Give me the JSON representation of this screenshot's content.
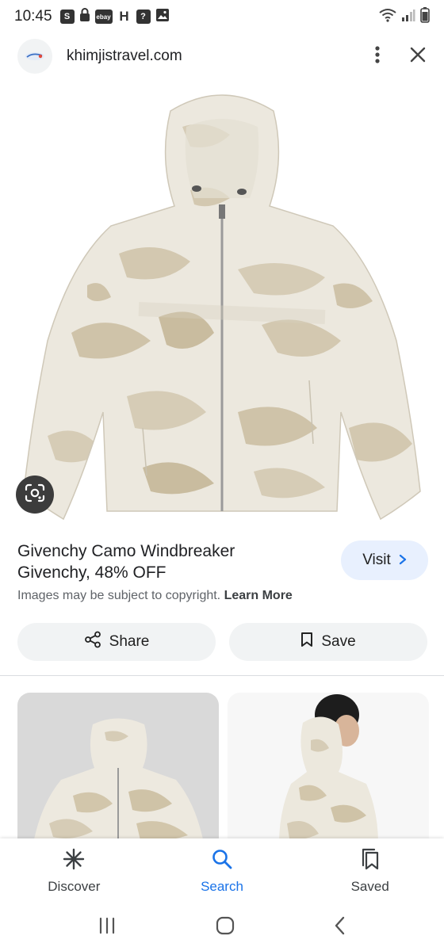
{
  "status_bar": {
    "time": "10:45",
    "notification_icons": [
      "S",
      "lock",
      "ebay",
      "H",
      "?",
      "image"
    ],
    "ebay_label": "ebay",
    "h_label": "H",
    "s_label": "S",
    "q_label": "?"
  },
  "url_bar": {
    "domain": "khimjistravel.com"
  },
  "product": {
    "title": "Givenchy Camo Windbreaker",
    "subtitle": "Givenchy, 48% OFF",
    "visit_label": "Visit",
    "copyright_text": "Images may be subject to copyright.",
    "learn_more": "Learn More"
  },
  "actions": {
    "share_label": "Share",
    "save_label": "Save"
  },
  "bottom_nav": {
    "items": [
      {
        "label": "Discover",
        "icon": "asterisk-icon"
      },
      {
        "label": "Search",
        "icon": "search-icon"
      },
      {
        "label": "Saved",
        "icon": "bookmarks-icon"
      }
    ],
    "active": "Search"
  },
  "colors": {
    "accent": "#1a73e8",
    "visit_bg": "#e8f0fe",
    "chip_bg": "#f1f3f4",
    "camo_base": "#ece8de",
    "camo_mid": "#d6ccb6",
    "camo_dark": "#bfb298"
  }
}
